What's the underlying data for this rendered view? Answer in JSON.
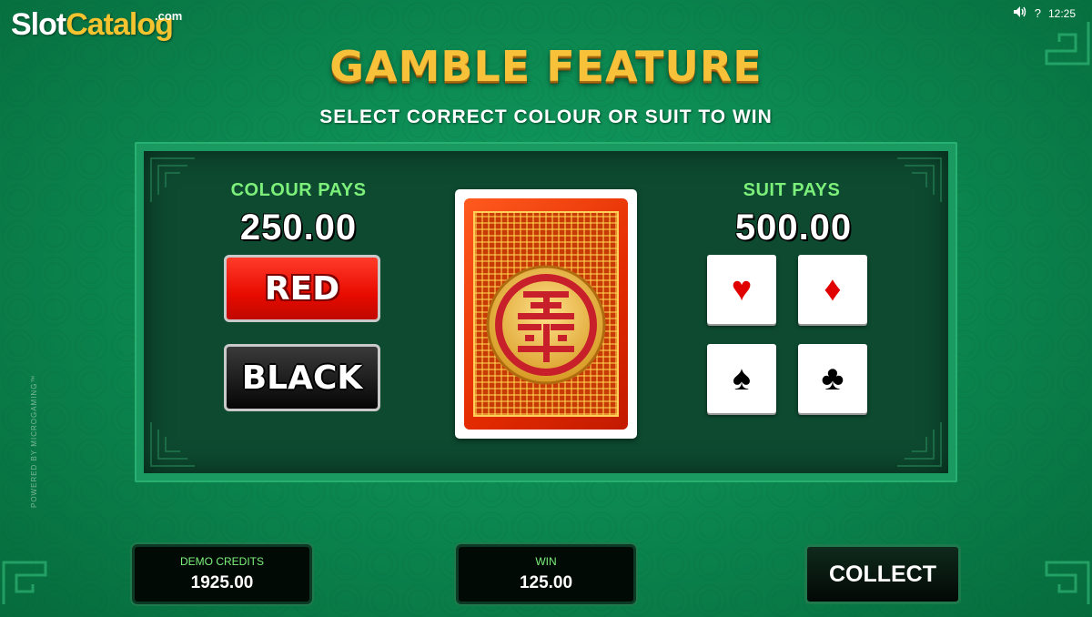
{
  "watermark": {
    "brand_part1": "Slot",
    "brand_part2": "Catalog",
    "suffix": ".com"
  },
  "status_bar": {
    "sound_icon": "speaker-icon",
    "help_label": "?",
    "time": "12:25"
  },
  "header": {
    "title": "GAMBLE FEATURE",
    "instruction": "SELECT CORRECT COLOUR OR SUIT TO WIN"
  },
  "colour_section": {
    "label": "COLOUR PAYS",
    "value": "250.00",
    "buttons": [
      {
        "label": "RED",
        "color": "#e80b00"
      },
      {
        "label": "BLACK",
        "color": "#050505"
      }
    ]
  },
  "card": {
    "state": "face-down",
    "back_color": "#e22b00",
    "accent_color": "#ffcf5a"
  },
  "suit_section": {
    "label": "SUIT PAYS",
    "value": "500.00",
    "suits": [
      {
        "name": "hearts",
        "symbol": "♥",
        "color": "#e00000"
      },
      {
        "name": "diamonds",
        "symbol": "♦",
        "color": "#e00000"
      },
      {
        "name": "spades",
        "symbol": "♠",
        "color": "#000000"
      },
      {
        "name": "clubs",
        "symbol": "♣",
        "color": "#000000"
      }
    ]
  },
  "footer": {
    "credits_label": "DEMO CREDITS",
    "credits_value": "1925.00",
    "win_label": "WIN",
    "win_value": "125.00",
    "collect_label": "COLLECT",
    "powered_by": "POWERED BY MICROGAMING™"
  },
  "colors": {
    "background": "#0c8a52",
    "panel": "#0d4a30",
    "pays_label": "#7cf07a",
    "title_gold": "#f7c23a"
  }
}
